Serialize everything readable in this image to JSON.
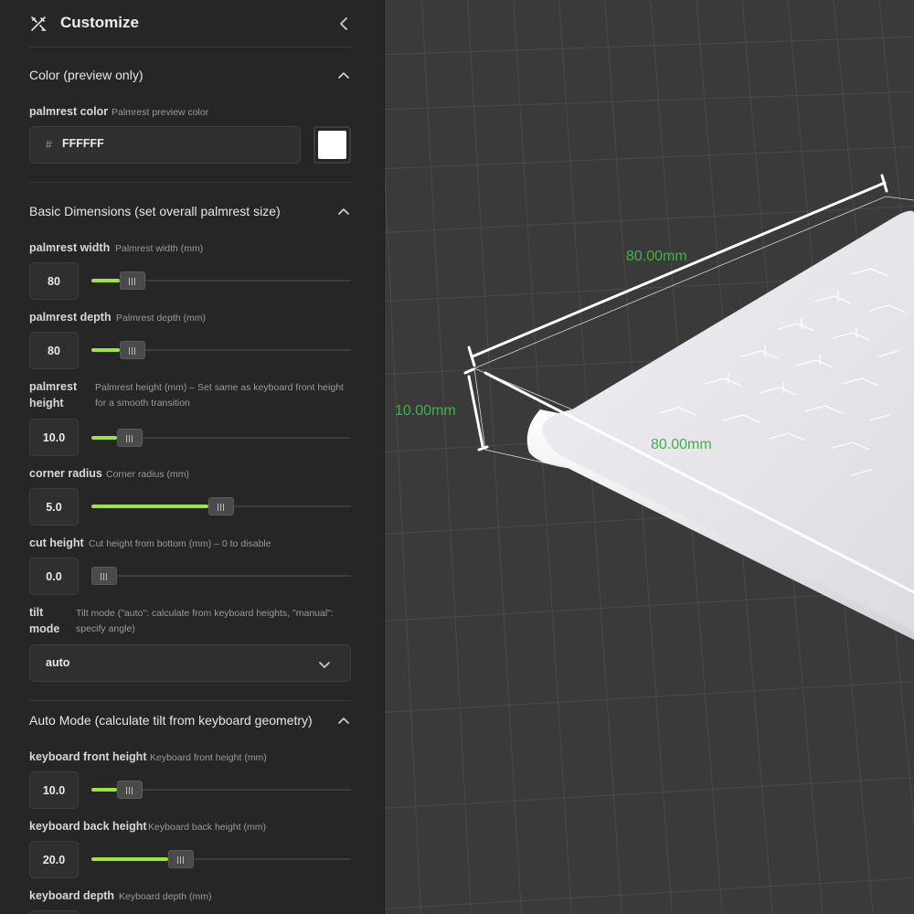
{
  "header": {
    "title": "Customize",
    "icon": "customize-tools-icon",
    "collapse_icon": "chevron-left-icon"
  },
  "sections": {
    "color": {
      "title": "Color (preview only)"
    },
    "basic": {
      "title": "Basic Dimensions (set overall palmrest size)"
    },
    "auto": {
      "title": "Auto Mode (calculate tilt from keyboard geometry)"
    }
  },
  "params": {
    "palmrest_color": {
      "label": "palmrest color",
      "desc": "Palmrest preview color",
      "hash": "#",
      "value": "FFFFFF",
      "swatch_color": "#ffffff"
    },
    "palmrest_width": {
      "label": "palmrest width",
      "desc": "Palmrest width (mm)",
      "value": "80",
      "fraction": 0.12
    },
    "palmrest_depth": {
      "label": "palmrest depth",
      "desc": "Palmrest depth (mm)",
      "value": "80",
      "fraction": 0.12
    },
    "palmrest_height": {
      "label": "palmrest height",
      "desc": "Palmrest height (mm) – Set same as keyboard front height for a smooth transition",
      "value": "10.0",
      "fraction": 0.11
    },
    "corner_radius": {
      "label": "corner radius",
      "desc": "Corner radius (mm)",
      "value": "5.0",
      "fraction": 0.5
    },
    "cut_height": {
      "label": "cut height",
      "desc": "Cut height from bottom (mm) – 0 to disable",
      "value": "0.0",
      "fraction": 0.0
    },
    "tilt_mode": {
      "label": "tilt mode",
      "desc": "Tilt mode (\"auto\": calculate from keyboard heights, \"manual\": specify angle)",
      "value": "auto"
    },
    "keyboard_front_height": {
      "label": "keyboard front height",
      "desc": "Keyboard front height (mm)",
      "value": "10.0",
      "fraction": 0.11
    },
    "keyboard_back_height": {
      "label": "keyboard back height",
      "desc": "Keyboard back height (mm)",
      "value": "20.0",
      "fraction": 0.33
    },
    "keyboard_depth": {
      "label": "keyboard depth",
      "desc": "Keyboard depth (mm)"
    }
  },
  "viewport": {
    "dimensions": {
      "width": "80.00mm",
      "height": "10.00mm",
      "depth": "80.00mm"
    },
    "colors": {
      "background": "#3a3a3a",
      "grid": "#4a4a4a",
      "measure": "#3fb34a",
      "accent": "#9fe33f"
    }
  }
}
